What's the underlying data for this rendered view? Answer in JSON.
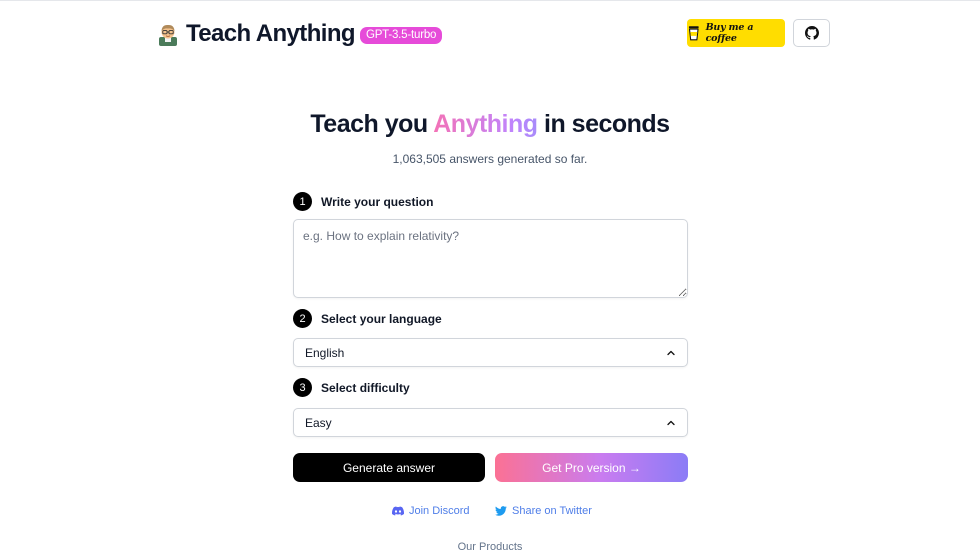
{
  "header": {
    "brand_name": "Teach Anything",
    "model_badge": "GPT-3.5-turbo",
    "coffee_label": "Buy me a coffee"
  },
  "hero": {
    "title_prefix": "Teach you",
    "title_highlight": "Anything",
    "title_suffix": "in seconds",
    "counter": "1,063,505 answers generated so far."
  },
  "form": {
    "step1": {
      "num": "1",
      "label": "Write your question"
    },
    "question_placeholder": "e.g. How to explain relativity?",
    "step2": {
      "num": "2",
      "label": "Select your language"
    },
    "language_value": "English",
    "step3": {
      "num": "3",
      "label": "Select difficulty"
    },
    "difficulty_value": "Easy",
    "generate_label": "Generate answer",
    "pro_label": "Get Pro version →"
  },
  "links": {
    "discord": "Join Discord",
    "twitter": "Share on Twitter"
  },
  "footer": {
    "products": "Our Products"
  },
  "colors": {
    "badge": "#e64bd9",
    "coffee": "#ffdd00",
    "link": "#4f7ee8",
    "gradient_start": "#fb7194",
    "gradient_end": "#8b7cf6"
  },
  "icons": [
    "teacher-emoji-icon",
    "coffee-cup-icon",
    "github-icon",
    "chevron-up-icon",
    "discord-icon",
    "twitter-icon"
  ]
}
